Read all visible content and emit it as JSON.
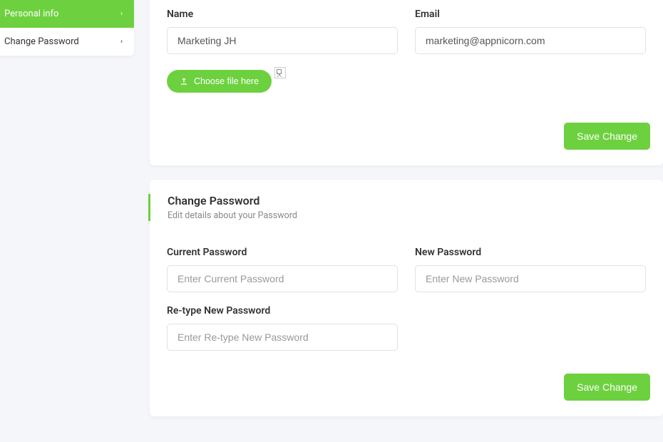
{
  "sidebar": {
    "items": [
      {
        "label": "Personal info",
        "active": true
      },
      {
        "label": "Change Password",
        "active": false
      }
    ]
  },
  "profile": {
    "name_label": "Name",
    "name_value": "Marketing JH",
    "email_label": "Email",
    "email_value": "marketing@appnicorn.com",
    "choose_file_label": "Choose file here",
    "save_label": "Save Change"
  },
  "password": {
    "title": "Change Password",
    "subtitle": "Edit details about your Password",
    "current_label": "Current Password",
    "current_placeholder": "Enter Current Password",
    "new_label": "New Password",
    "new_placeholder": "Enter New Password",
    "retype_label": "Re-type New Password",
    "retype_placeholder": "Enter Re-type New Password",
    "save_label": "Save Change"
  }
}
